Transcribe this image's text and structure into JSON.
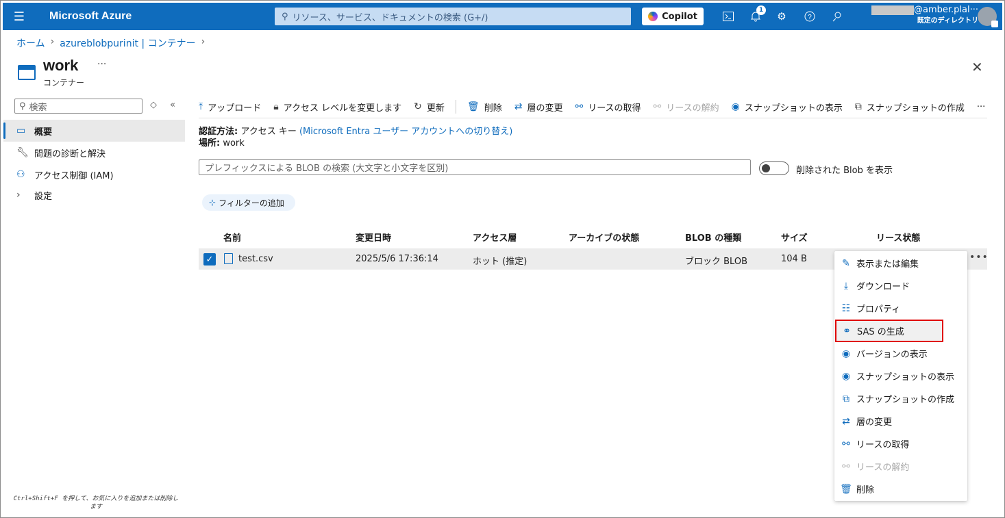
{
  "topbar": {
    "brand": "Microsoft Azure",
    "search_placeholder": "リソース、サービス、ドキュメントの検索 (G+/)",
    "copilot": "Copilot",
    "notification_count": "1",
    "user_email_suffix": "@amber.plal···",
    "user_directory": "既定のディレクトリ"
  },
  "breadcrumb": {
    "home": "ホーム",
    "parent": "azureblobpurinit | コンテナー"
  },
  "page": {
    "title": "work",
    "more": "···",
    "subtitle": "コンテナー"
  },
  "sidebar": {
    "search_placeholder": "検索",
    "items": [
      {
        "label": "概要",
        "icon": "overview-icon"
      },
      {
        "label": "問題の診断と解決",
        "icon": "wrench-icon"
      },
      {
        "label": "アクセス制御 (IAM)",
        "icon": "people-icon"
      },
      {
        "label": "設定",
        "icon": "chevron-right-icon"
      }
    ],
    "footer": "Ctrl+Shift+F を押して、お気に入りを追加または削除します"
  },
  "toolbar": {
    "upload": "アップロード",
    "access_level": "アクセス レベルを変更します",
    "refresh": "更新",
    "delete": "削除",
    "change_tier": "層の変更",
    "acquire_lease": "リースの取得",
    "break_lease": "リースの解約",
    "view_snapshots": "スナップショットの表示",
    "create_snapshot": "スナップショットの作成",
    "more": "···"
  },
  "auth": {
    "method_label": "認証方法:",
    "method_value": "アクセス キー",
    "switch_link": "(Microsoft Entra ユーザー アカウントへの切り替え)",
    "location_label": "場所:",
    "location_value": "work"
  },
  "blob_search_placeholder": "プレフィックスによる BLOB の検索 (大文字と小文字を区別)",
  "show_deleted_label": "削除された Blob を表示",
  "add_filter": "フィルターの追加",
  "table": {
    "headers": [
      "名前",
      "変更日時",
      "アクセス層",
      "アーカイブの状態",
      "BLOB の種類",
      "サイズ",
      "リース状態"
    ],
    "rows": [
      {
        "name": "test.csv",
        "modified": "2025/5/6 17:36:14",
        "tier": "ホット (推定)",
        "archive": "",
        "blob_type": "ブロック BLOB",
        "size": "104 B",
        "lease": ""
      }
    ]
  },
  "context_menu": {
    "items": [
      {
        "label": "表示または編集",
        "icon": "pencil-icon"
      },
      {
        "label": "ダウンロード",
        "icon": "download-icon"
      },
      {
        "label": "プロパティ",
        "icon": "properties-icon"
      },
      {
        "label": "SAS の生成",
        "icon": "link-icon"
      },
      {
        "label": "バージョンの表示",
        "icon": "eye-icon"
      },
      {
        "label": "スナップショットの表示",
        "icon": "eye-icon"
      },
      {
        "label": "スナップショットの作成",
        "icon": "snapshot-icon"
      },
      {
        "label": "層の変更",
        "icon": "swap-icon"
      },
      {
        "label": "リースの取得",
        "icon": "lease-icon"
      },
      {
        "label": "リースの解約",
        "icon": "break-lease-icon"
      },
      {
        "label": "削除",
        "icon": "trash-icon"
      }
    ]
  },
  "colors": {
    "brand": "#0f6cbd",
    "highlight": "#e00000"
  }
}
